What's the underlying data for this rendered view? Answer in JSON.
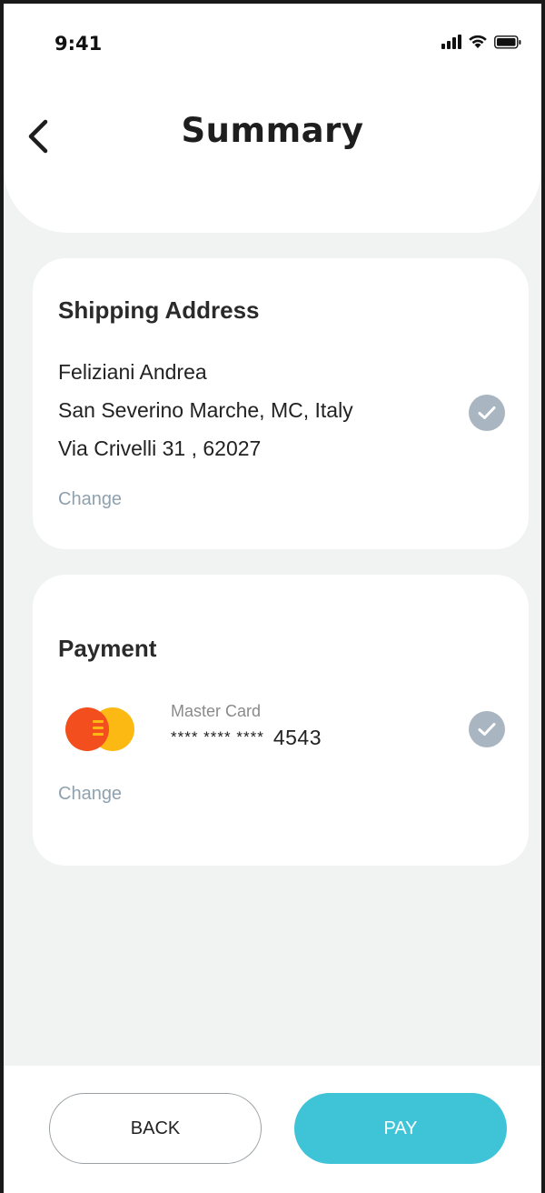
{
  "status_bar": {
    "time": "9:41"
  },
  "header": {
    "title": "Summary"
  },
  "shipping": {
    "title": "Shipping Address",
    "lines": [
      "Feliziani Andrea",
      "San Severino Marche, MC, Italy",
      "Via Crivelli 31 , 62027"
    ],
    "change_label": "Change",
    "selected": true
  },
  "payment": {
    "title": "Payment",
    "card_brand": "Master Card",
    "masked": "**** **** ****",
    "last4": "4543",
    "change_label": "Change",
    "selected": true
  },
  "actions": {
    "back_label": "BACK",
    "pay_label": "PAY"
  },
  "colors": {
    "accent": "#3ec4d6",
    "check": "#a9b6c1",
    "link": "#8fa1ae",
    "background": "#f1f2f2"
  },
  "icons": [
    "signal-icon",
    "wifi-icon",
    "battery-icon",
    "back-chevron-icon",
    "check-icon",
    "mastercard-logo"
  ]
}
